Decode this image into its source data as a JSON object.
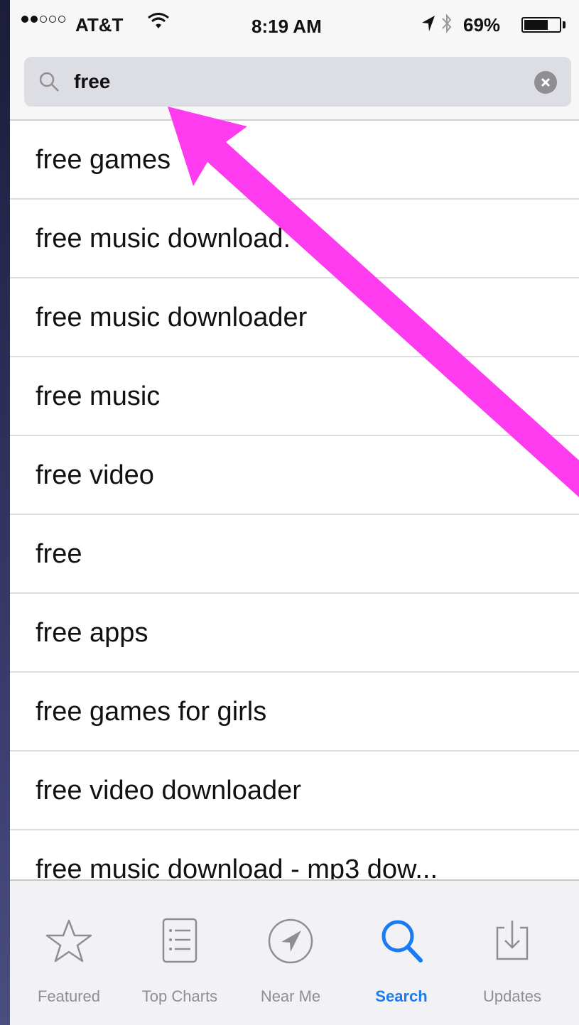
{
  "status_bar": {
    "carrier": "AT&T",
    "time": "8:19 AM",
    "battery_percent": "69%",
    "battery_level": 0.69,
    "signal_bars_filled": 2,
    "signal_bars_total": 5
  },
  "search": {
    "query": "free",
    "icon": "search-icon",
    "clear_icon": "clear-icon"
  },
  "suggestions": [
    "free games",
    "free music download.",
    "free music downloader",
    "free music",
    "free video",
    "free",
    "free apps",
    "free games for girls",
    "free video downloader",
    "free music download - mp3 dow..."
  ],
  "tab_bar": {
    "tabs": [
      {
        "label": "Featured",
        "icon": "star-icon",
        "active": false
      },
      {
        "label": "Top Charts",
        "icon": "list-icon",
        "active": false
      },
      {
        "label": "Near Me",
        "icon": "location-icon",
        "active": false
      },
      {
        "label": "Search",
        "icon": "search-icon",
        "active": true
      },
      {
        "label": "Updates",
        "icon": "download-icon",
        "active": false
      }
    ]
  },
  "colors": {
    "accent": "#1a7cf5",
    "annotation": "#ff3bf0",
    "inactive": "#8e8e93"
  }
}
